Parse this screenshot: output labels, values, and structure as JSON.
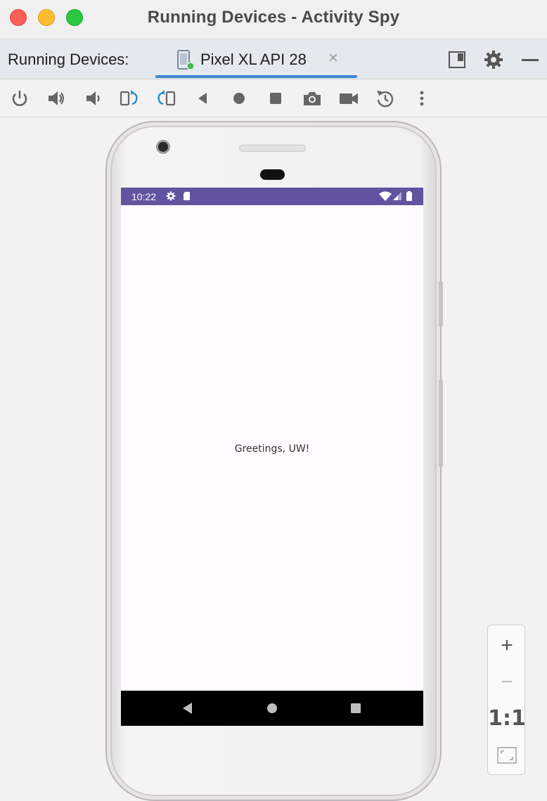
{
  "window": {
    "title": "Running Devices - Activity Spy"
  },
  "tabbar": {
    "label": "Running Devices:",
    "tab": {
      "label": "Pixel XL API 28",
      "close_glyph": "×",
      "icon": "device-icon"
    },
    "actions": [
      {
        "name": "layout-toggle-icon"
      },
      {
        "name": "gear-icon"
      },
      {
        "name": "minimize-icon"
      }
    ]
  },
  "toolbar": {
    "tools": [
      "power-icon",
      "volume-up-icon",
      "volume-down-icon",
      "rotate-left-icon",
      "rotate-right-icon",
      "back-icon",
      "home-icon",
      "overview-icon",
      "screenshot-icon",
      "screen-record-icon",
      "reset-icon",
      "more-options-icon"
    ]
  },
  "device": {
    "status_bar": {
      "time": "10:22",
      "color": "#6153a0"
    },
    "content": {
      "text": "Greetings, UW!"
    },
    "nav_bar": {
      "buttons": [
        "back",
        "home",
        "overview"
      ]
    }
  },
  "zoom": {
    "zoom_in": "+",
    "zoom_out": "−",
    "actual_size": "1:1",
    "fit_icon": "fit-screen-icon"
  },
  "colors": {
    "accent": "#3d84d4",
    "toolbar_blue": "#2a8ccf",
    "icon_gray": "#6e6e6e"
  }
}
